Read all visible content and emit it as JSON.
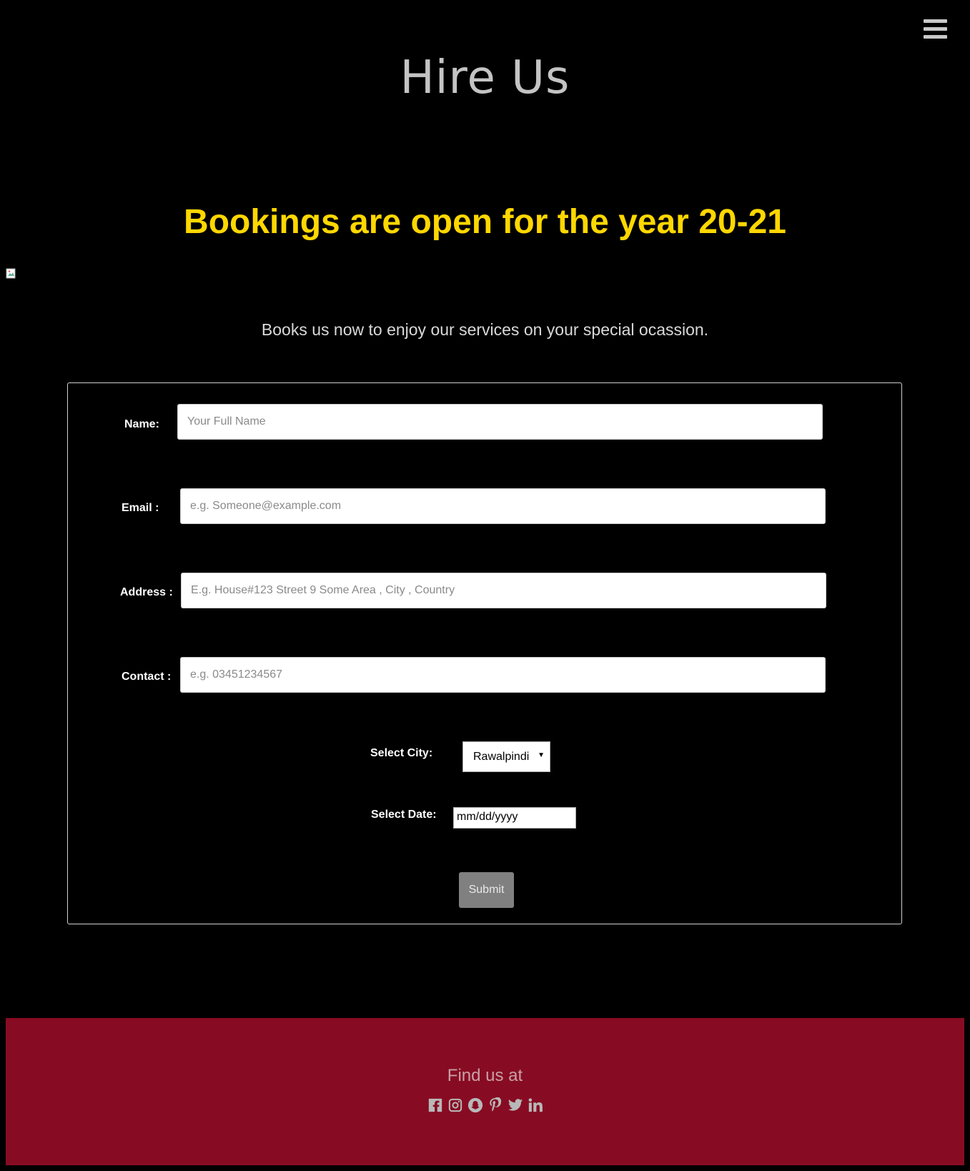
{
  "header": {
    "title": "Hire Us",
    "menu_icon": "hamburger-menu-icon"
  },
  "hero": {
    "headline": "Bookings are open for the year 20-21",
    "intro": "Books us now to enjoy our services on your special ocassion."
  },
  "form": {
    "name": {
      "label": "Name:",
      "placeholder": "Your Full Name",
      "value": ""
    },
    "email": {
      "label": "Email :",
      "placeholder": "e.g. Someone@example.com",
      "value": ""
    },
    "address": {
      "label": "Address :",
      "placeholder": "E.g. House#123 Street 9 Some Area , City , Country",
      "value": ""
    },
    "contact": {
      "label": "Contact :",
      "placeholder": "e.g. 03451234567",
      "value": ""
    },
    "city": {
      "label": "Select City:",
      "selected": "Rawalpindi"
    },
    "date": {
      "label": "Select Date:",
      "value": "mm/dd/yyyy"
    },
    "submit_label": "Submit"
  },
  "footer": {
    "title": "Find us at",
    "social_icons": [
      "facebook-icon",
      "instagram-icon",
      "snapchat-icon",
      "pinterest-icon",
      "twitter-icon",
      "linkedin-icon"
    ],
    "background_color": "#870c23"
  },
  "colors": {
    "background": "#000000",
    "headline": "#ffd700",
    "title": "#c4c4c4",
    "submit": "#808080"
  }
}
